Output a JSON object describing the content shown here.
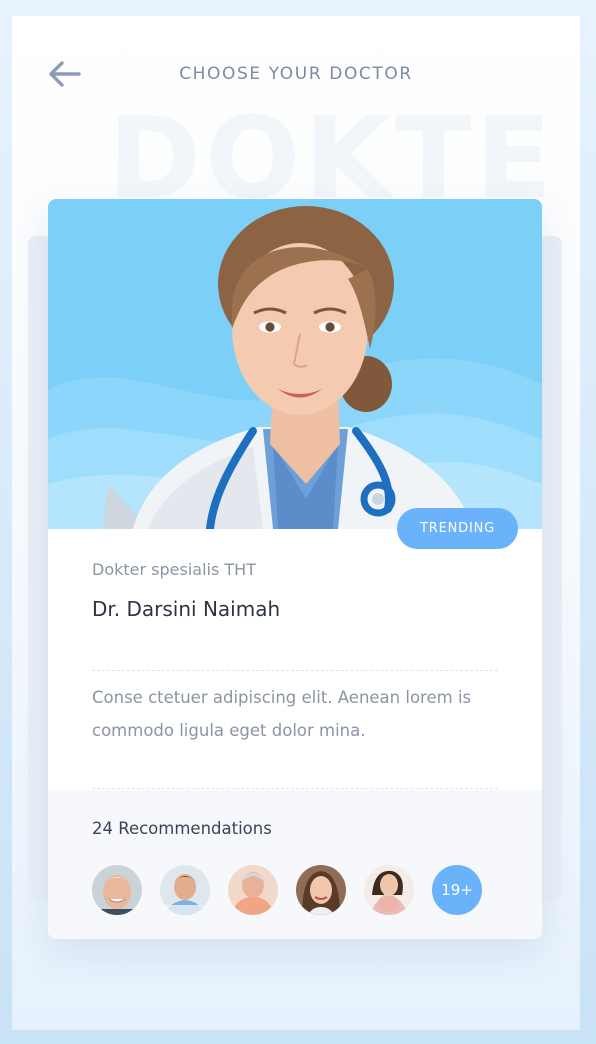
{
  "header": {
    "title": "CHOOSE YOUR DOCTOR",
    "watermark": "DOKTE"
  },
  "doctor": {
    "badge": "TRENDING",
    "specialty": "Dokter spesialis THT",
    "name": "Dr. Darsini Naimah",
    "description": "Conse ctetuer adipiscing elit. Aenean lorem is commodo ligula eget dolor mina."
  },
  "recommendations": {
    "label": "24 Recommendations",
    "more_count": "19+",
    "avatars": [
      "elderly-man",
      "young-man",
      "older-man",
      "woman-smiling",
      "woman-with-child"
    ]
  },
  "colors": {
    "accent": "#6ab3fb",
    "photo_bg": "#7cd0f8",
    "title": "#7d8aa6",
    "text_dark": "#2c3444",
    "text_muted": "#8b94a6"
  }
}
